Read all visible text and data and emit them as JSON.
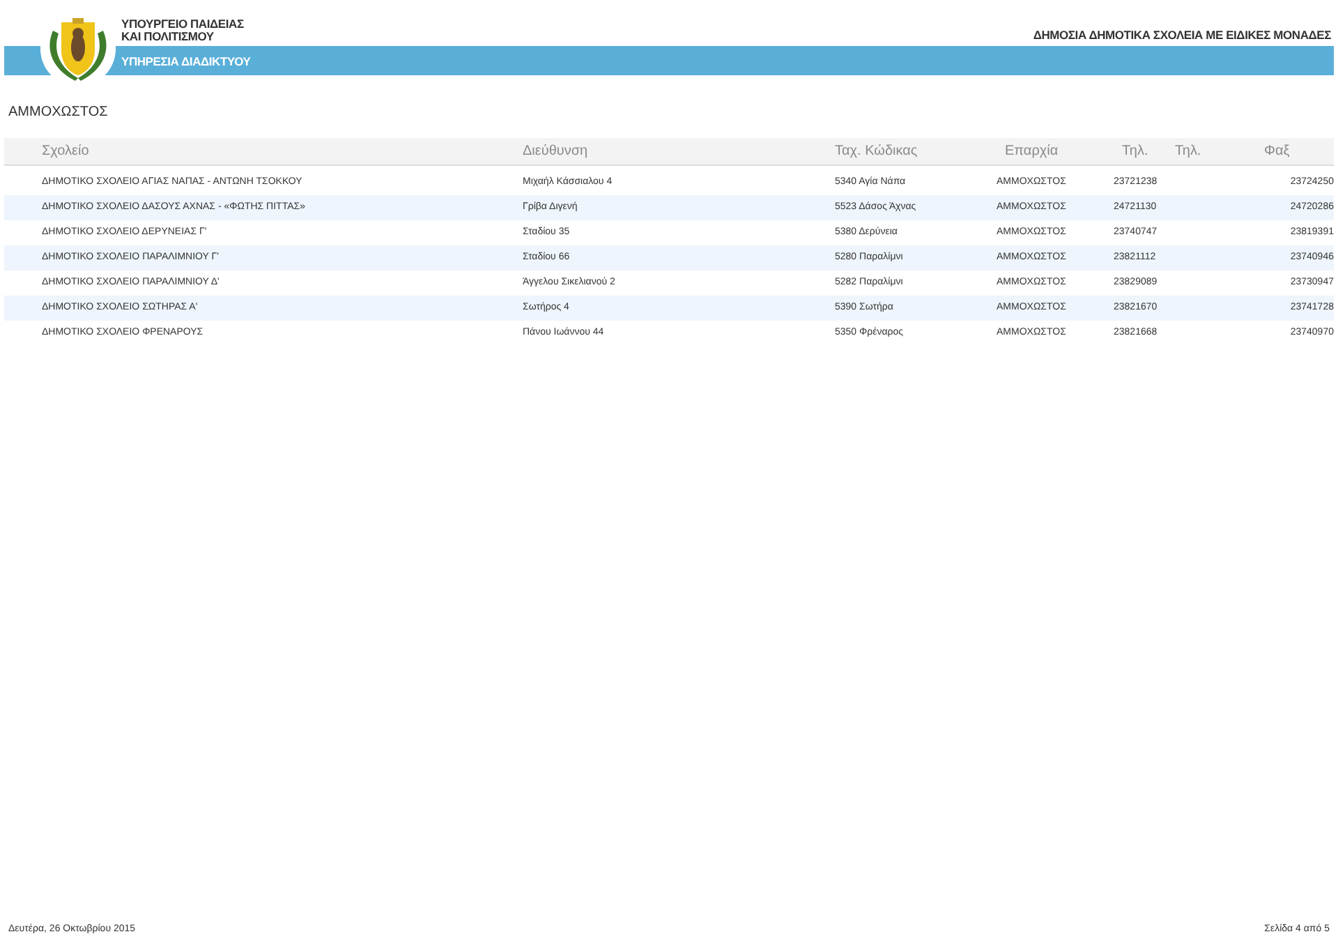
{
  "header": {
    "ministry_lines": [
      "ΥΠΟΥΡΓΕΙΟ ΠΑΙΔΕΙΑΣ",
      "ΚΑΙ ΠΟΛΙΤΙΣΜΟΥ"
    ],
    "service": "ΥΠΗΡΕΣΙΑ ΔΙΑΔΙΚΤΥΟΥ",
    "report_title": "ΔΗΜΟΣΙΑ ΔΗΜΟΤΙΚΑ ΣΧΟΛΕΙΑ ΜΕ ΕΙΔΙΚΕΣ ΜΟΝΑΔΕΣ"
  },
  "district_title": "ΑΜΜΟΧΩΣΤΟΣ",
  "table": {
    "columns": [
      "Σχολείο",
      "Διεύθυνση",
      "Ταχ. Κώδικας",
      "Επαρχία",
      "Τηλ.",
      "Τηλ.",
      "Φαξ"
    ],
    "rows": [
      [
        "ΔΗΜΟΤΙΚΟ ΣΧΟΛΕΙΟ ΑΓΙΑΣ ΝΑΠΑΣ - ΑΝΤΩΝΗ ΤΣΟΚΚΟΥ",
        "Μιχαήλ Κάσσιαλου 4",
        "5340 Αγία Νάπα",
        "ΑΜΜΟΧΩΣΤΟΣ",
        "23721238",
        "",
        "23724250"
      ],
      [
        "ΔΗΜΟΤΙΚΟ ΣΧΟΛΕΙΟ ΔΑΣΟΥΣ ΑΧΝΑΣ - «ΦΩΤΗΣ ΠΙΤΤΑΣ»",
        "Γρίβα Διγενή",
        "5523 Δάσος Άχνας",
        "ΑΜΜΟΧΩΣΤΟΣ",
        "24721130",
        "",
        "24720286"
      ],
      [
        "ΔΗΜΟΤΙΚΟ ΣΧΟΛΕΙΟ ΔΕΡΥΝΕΙΑΣ Γ'",
        "Σταδίου 35",
        "5380 Δερύνεια",
        "ΑΜΜΟΧΩΣΤΟΣ",
        "23740747",
        "",
        "23819391"
      ],
      [
        "ΔΗΜΟΤΙΚΟ ΣΧΟΛΕΙΟ ΠΑΡΑΛΙΜΝΙΟΥ Γ'",
        "Σταδίου 66",
        "5280 Παραλίμνι",
        "ΑΜΜΟΧΩΣΤΟΣ",
        "23821112",
        "",
        "23740946"
      ],
      [
        "ΔΗΜΟΤΙΚΟ ΣΧΟΛΕΙΟ ΠΑΡΑΛΙΜΝΙΟΥ Δ'",
        "Άγγελου Σικελιανού 2",
        "5282 Παραλίμνι",
        "ΑΜΜΟΧΩΣΤΟΣ",
        "23829089",
        "",
        "23730947"
      ],
      [
        "ΔΗΜΟΤΙΚΟ ΣΧΟΛΕΙΟ ΣΩΤΗΡΑΣ Α'",
        "Σωτήρος 4",
        "5390 Σωτήρα",
        "ΑΜΜΟΧΩΣΤΟΣ",
        "23821670",
        "",
        "23741728"
      ],
      [
        "ΔΗΜΟΤΙΚΟ ΣΧΟΛΕΙΟ ΦΡΕΝΑΡΟΥΣ",
        "Πάνου Ιωάννου 44",
        "5350 Φρέναρος",
        "ΑΜΜΟΧΩΣΤΟΣ",
        "23821668",
        "",
        "23740970"
      ]
    ]
  },
  "footer": {
    "date": "Δευτέρα, 26 Οκτωβρίου 2015",
    "page": "Σελίδα 4 από 5"
  }
}
